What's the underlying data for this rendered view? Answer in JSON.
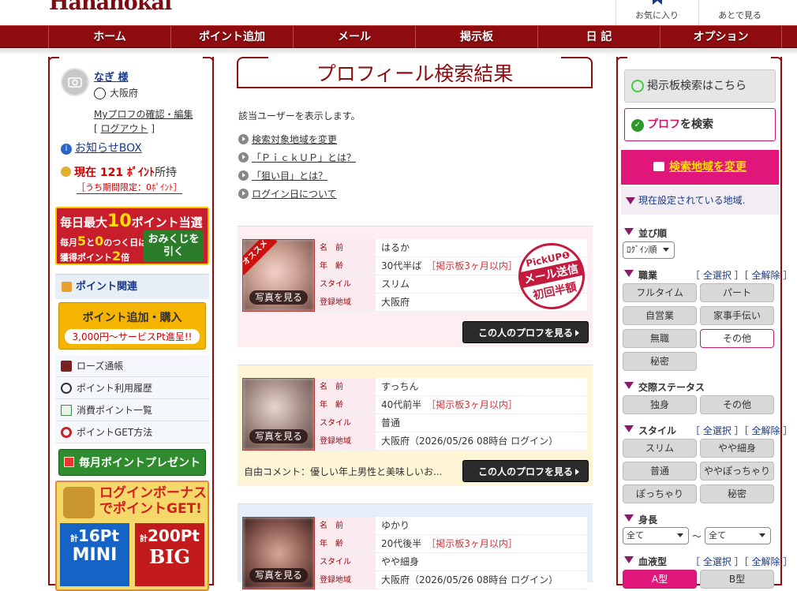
{
  "header": {
    "logo": "Hananokai",
    "favorites_label": "お気に入り",
    "later_label": "あとで見る"
  },
  "nav": [
    "ホーム",
    "ポイント追加",
    "メール",
    "掲示板",
    "日 記",
    "オプション"
  ],
  "left": {
    "user_name": "なぎ 様",
    "prefecture": "大阪府",
    "profile_edit": "Myプロフの確認・編集",
    "logout": "ログアウト",
    "notice": "お知らせBOX",
    "points_prefix": "現在",
    "points_value": "121",
    "points_unit": "ﾎﾟｲﾝﾄ",
    "points_suffix": "所持",
    "limited": "［うち期間限定：0ﾎﾟｲﾝﾄ］",
    "banner1": {
      "line1a": "毎日最大",
      "line1b": "10",
      "line1c": "ポイント当選",
      "line2a": "毎月",
      "line2b": "5",
      "line2c": "と",
      "line2d": "0",
      "line2e": "のつく日は",
      "line3a": "獲得ポイント",
      "line3b": "2",
      "line3c": "倍",
      "button": "おみくじを引く"
    },
    "points_section": "ポイント関連",
    "add_points": "ポイント追加・購入",
    "add_points_sub": "3,000円〜サービスPt進呈!!",
    "menu": [
      "ローズ通帳",
      "ポイント利用履歴",
      "消費ポイント一覧",
      "ポイントGET方法"
    ],
    "monthly_present": "毎月ポイントプレゼント",
    "login_bonus": {
      "line1": "ログインボーナス",
      "line2": "でポイントGET!",
      "mini_pts": "16Pt",
      "mini_label": "MINI",
      "big_pts": "200Pt",
      "big_label": "BIG",
      "total": "計"
    }
  },
  "center": {
    "title": "プロフィール検索結果",
    "intro": "該当ユーザーを表示します。",
    "links": [
      "検索対象地域を変更",
      "「ＰｉｃｋＵＰ」とは？",
      "「狙い目」とは？",
      "ログイン日について"
    ],
    "labels": {
      "name": "名　前",
      "age": "年　齢",
      "style": "スタイル",
      "area": "登録地域"
    },
    "see_photo": "写真を見る",
    "recommend": "オススメ",
    "view_button": "この人のプロフを見る",
    "stamp": {
      "l1": "PickUP❶",
      "l2": "メール送信",
      "l3": "初回半額"
    },
    "results": [
      {
        "name": "はるか",
        "age": "30代半ば",
        "age_note": "［掲示板3ヶ月以内］",
        "style": "スリム",
        "area": "大阪府",
        "comment": ""
      },
      {
        "name": "すっちん",
        "age": "40代前半",
        "age_note": "［掲示板3ヶ月以内］",
        "style": "普通",
        "area": "大阪府（2026/05/26 08時台 ログイン）",
        "comment": "自由コメント：優しい年上男性と美味しいお..."
      },
      {
        "name": "ゆかり",
        "age": "20代後半",
        "age_note": "［掲示板3ヶ月以内］",
        "style": "やや細身",
        "area": "大阪府（2026/05/26 08時台 ログイン）",
        "comment": ""
      }
    ]
  },
  "right": {
    "board_search": "掲示板検索はこちら",
    "prof_search_a": "プロフ",
    "prof_search_b": "を検索",
    "change_area": "検索地域を変更",
    "current_area": "現在設定されている地域.",
    "sort_label": "並び順",
    "sort_value": "ﾛｸﾞｲﾝ順",
    "select_all": "［ 全選択 ］",
    "deselect_all": "［ 全解除 ］",
    "job_label": "職業",
    "jobs": [
      "フルタイム",
      "パート",
      "自営業",
      "家事手伝い",
      "無職",
      "その他",
      "秘密"
    ],
    "status_label": "交際ステータス",
    "statuses": [
      "独身",
      "その他"
    ],
    "style_label": "スタイル",
    "styles": [
      "スリム",
      "やや細身",
      "普通",
      "ややぽっちゃり",
      "ぽっちゃり",
      "秘密"
    ],
    "height_label": "身長",
    "height_from": "全て",
    "height_to": "全て",
    "tilde": "〜",
    "blood_label": "血液型",
    "bloods": [
      "A型",
      "B型"
    ]
  }
}
